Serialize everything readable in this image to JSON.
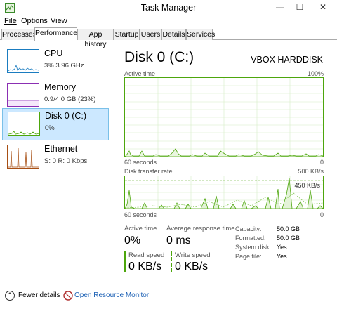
{
  "window": {
    "title": "Task Manager",
    "minimize_glyph": "—",
    "maximize_glyph": "☐",
    "close_glyph": "✕"
  },
  "menu": {
    "file": "File",
    "options": "Options",
    "view": "View"
  },
  "tabs": [
    {
      "label": "Processes"
    },
    {
      "label": "Performance"
    },
    {
      "label": "App history"
    },
    {
      "label": "Startup"
    },
    {
      "label": "Users"
    },
    {
      "label": "Details"
    },
    {
      "label": "Services"
    }
  ],
  "resources": [
    {
      "name": "CPU",
      "sub": "3% 3.96 GHz",
      "color": "#1a7cc0"
    },
    {
      "name": "Memory",
      "sub": "0.9/4.0 GB (23%)",
      "color": "#8b2fb3"
    },
    {
      "name": "Disk 0 (C:)",
      "sub": "0%",
      "color": "#4da60c"
    },
    {
      "name": "Ethernet",
      "sub": "S: 0 R: 0 Kbps",
      "color": "#a74f14"
    }
  ],
  "detail": {
    "title": "Disk 0 (C:)",
    "model": "VBOX HARDDISK",
    "active_time_label": "Active time",
    "active_time_max": "100%",
    "graph1_left": "60 seconds",
    "graph1_right": "0",
    "transfer_label": "Disk transfer rate",
    "transfer_max": "500 KB/s",
    "transfer_mid": "450 KB/s",
    "graph2_left": "60 seconds",
    "graph2_right": "0",
    "stats": {
      "active_time_label": "Active time",
      "active_time_value": "0%",
      "avg_resp_label": "Average response time",
      "avg_resp_value": "0 ms",
      "read_label": "Read speed",
      "read_value": "0 KB/s",
      "write_label": "Write speed",
      "write_value": "0 KB/s"
    },
    "info": [
      {
        "label": "Capacity:",
        "value": "50.0 GB"
      },
      {
        "label": "Formatted:",
        "value": "50.0 GB"
      },
      {
        "label": "System disk:",
        "value": "Yes"
      },
      {
        "label": "Page file:",
        "value": "Yes"
      }
    ]
  },
  "bottom": {
    "fewer_details": "Fewer details",
    "open_resource_monitor": "Open Resource Monitor"
  },
  "colors": {
    "disk_green": "#4da60c",
    "selected_bg": "#cce8ff"
  }
}
